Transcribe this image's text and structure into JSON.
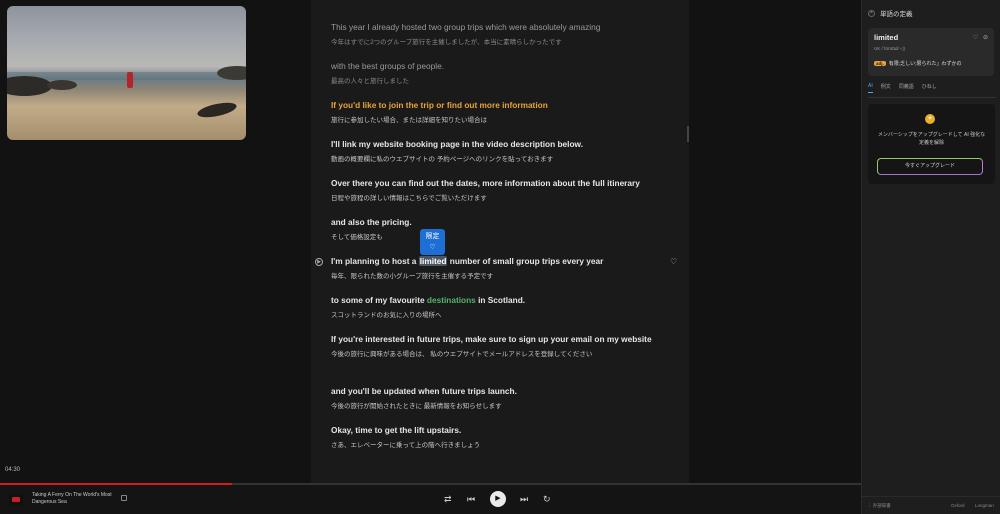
{
  "player": {
    "timestamp": "04:30",
    "progress_fraction": 0.27,
    "video_title": "Taking A Ferry On The World's Most Dangerous Sea",
    "controls": {
      "repeat_icon": "repeat-icon",
      "prev_icon": "skip-back-icon",
      "play_icon": "play-icon",
      "next_icon": "skip-forward-icon",
      "speed_icon": "speed-icon"
    }
  },
  "transcript": [
    {
      "en": "This year I already hosted two group trips which were absolutely amazing",
      "jp": "今年はすでに2つのグループ旅行を主催しましたが、本当に素晴らしかったです"
    },
    {
      "en": "with the best groups of people.",
      "jp": "最高の人々と旅行しました"
    },
    {
      "en": "If you'd like to join the trip or find out more information",
      "jp": "旅行に参加したい場合、または詳細を知りたい場合は"
    },
    {
      "en": "I'll link my website booking page in the video description below.",
      "jp": "動画の概要欄に私のウエブサイトの 予約ページへのリンクを貼っておきます"
    },
    {
      "en": "Over there you can find out the dates, more information about the full itinerary",
      "jp": "日程や旅程の詳しい情報はこちらでご覧いただけます"
    },
    {
      "en": "and also the pricing.",
      "jp": "そして価格設定も"
    },
    {
      "en_before": "I'm planning to host a ",
      "en_word": "limited",
      "en_after": " number of small group trips every year",
      "jp": "毎年、限られた数の小グループ旅行を主催する予定です"
    },
    {
      "en_before": "to some of my favourite ",
      "en_word": "destinations",
      "en_after": " in Scotland.",
      "jp": "スコットランドのお気に入りの場所へ"
    },
    {
      "en": "If you're interested in future trips, make sure to sign up your email on my website",
      "jp": "今後の旅行に興味がある場合は、 私のウエブサイトでメールアドレスを登録してください"
    },
    {
      "en": "and you'll be updated when future trips launch.",
      "jp": "今後の旅行が開始されたときに 最新情報をお知らせします"
    },
    {
      "en": "Okay, time to get the lift upstairs.",
      "jp": "さあ、エレベーターに乗って上の階へ行きましょう"
    }
  ],
  "tooltip": {
    "word": "限定",
    "heart_icon": "heart-icon"
  },
  "panel": {
    "title": "単語の定義",
    "word": "limited",
    "phonetic": "UK /ˈlɪmɪtɪd/ ◁)",
    "pos": "adj.",
    "definition": "有限;乏しい;限られた」わずかの",
    "tabs": [
      "AI",
      "例文",
      "同義語",
      "ひねし"
    ],
    "upgrade_text": "メンバーシップをアップグレードして AI 強化な定義を解除",
    "upgrade_button": "今すぐアップグレード",
    "footer_left": "⋮ 外部辞書",
    "footer_r1": "Oxford",
    "footer_r2": "Longman"
  }
}
